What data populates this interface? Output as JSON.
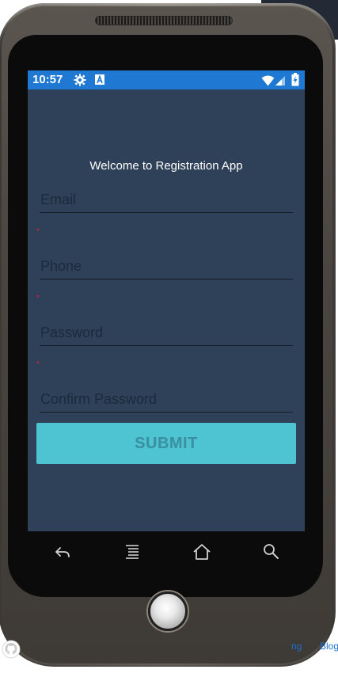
{
  "status_bar": {
    "time": "10:57",
    "left_icons": [
      "gear-icon",
      "a-notification-icon"
    ],
    "right_icons": [
      "wifi-icon",
      "cellular-signal-icon",
      "battery-charging-icon"
    ],
    "color": "#1f78d1"
  },
  "app": {
    "background": "#2e4158",
    "welcome_text": "Welcome to Registration App",
    "fields": [
      {
        "placeholder": "Email",
        "value": "",
        "required_marker": "*"
      },
      {
        "placeholder": "Phone",
        "value": "",
        "required_marker": "*"
      },
      {
        "placeholder": "Password",
        "value": "",
        "required_marker": "*"
      },
      {
        "placeholder": "Confirm Password",
        "value": ""
      }
    ],
    "submit_label": "SUBMIT",
    "submit_color": "#4ec3d2"
  },
  "phone_keys": [
    "back-icon",
    "menu-icon",
    "home-icon",
    "search-icon"
  ],
  "footer": {
    "icon": "github-icon",
    "links": [
      "ng",
      "Blog"
    ]
  }
}
